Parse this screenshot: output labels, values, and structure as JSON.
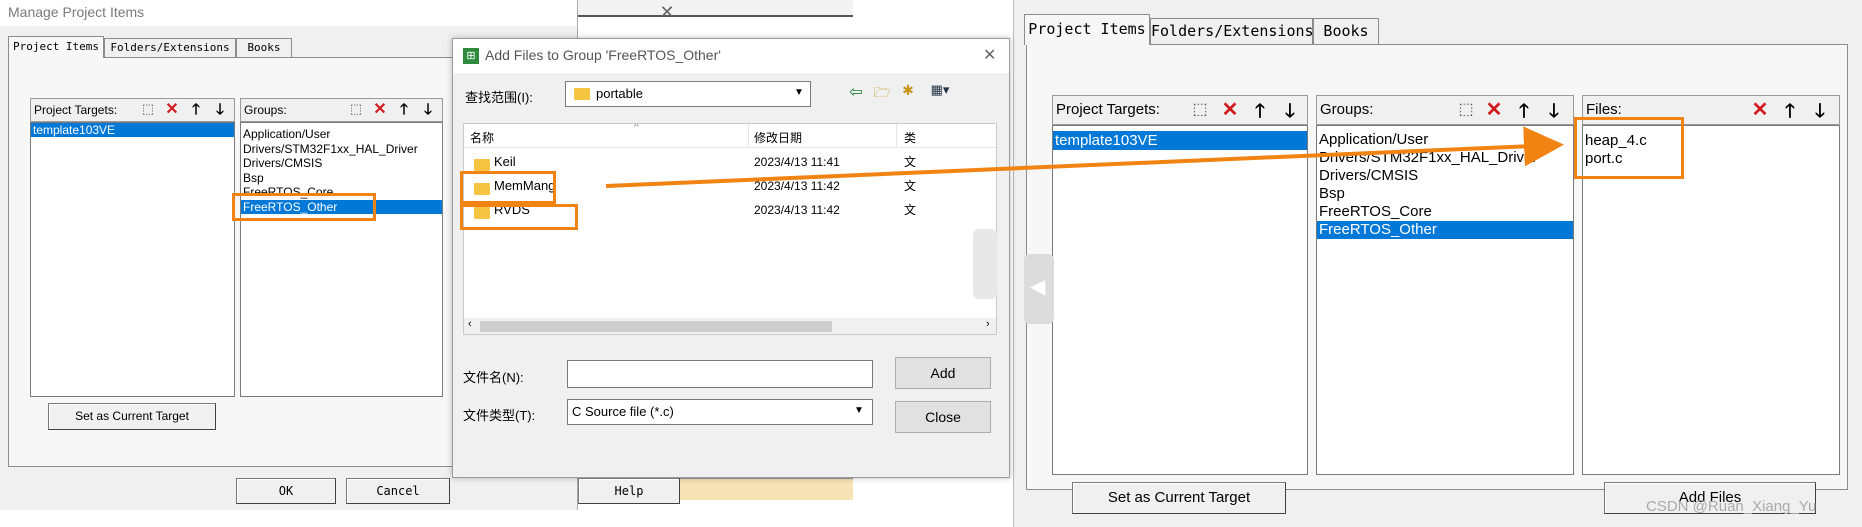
{
  "manage": {
    "title": "Manage Project Items",
    "tabs": [
      "Project Items",
      "Folders/Extensions",
      "Books"
    ],
    "targets_label": "Project Targets:",
    "targets": [
      "template103VE"
    ],
    "groups_label": "Groups:",
    "groups": [
      "Application/User",
      "Drivers/STM32F1xx_HAL_Driver",
      "Drivers/CMSIS",
      "Bsp",
      "FreeRTOS_Core",
      "FreeRTOS_Other"
    ],
    "set_target_button": "Set as Current Target",
    "ok_button": "OK",
    "cancel_button": "Cancel",
    "help_button": "Help"
  },
  "addfiles": {
    "title": "Add Files to Group 'FreeRTOS_Other'",
    "look_in_label": "查找范围(I):",
    "look_in_value": "portable",
    "col_name": "名称",
    "col_date": "修改日期",
    "col_type": "类",
    "rows": [
      {
        "name": "Keil",
        "date": "2023/4/13 11:41",
        "type": "文"
      },
      {
        "name": "MemMang",
        "date": "2023/4/13 11:42",
        "type": "文"
      },
      {
        "name": "RVDS",
        "date": "2023/4/13 11:42",
        "type": "文"
      }
    ],
    "filename_label": "文件名(N):",
    "filename_value": "",
    "filetype_label": "文件类型(T):",
    "filetype_value": "C Source file (*.c)",
    "add_button": "Add",
    "close_button": "Close"
  },
  "right": {
    "tabs": [
      "Project Items",
      "Folders/Extensions",
      "Books"
    ],
    "targets_label": "Project Targets:",
    "targets": [
      "template103VE"
    ],
    "groups_label": "Groups:",
    "groups": [
      "Application/User",
      "Drivers/STM32F1xx_HAL_Driver",
      "Drivers/CMSIS",
      "Bsp",
      "FreeRTOS_Core",
      "FreeRTOS_Other"
    ],
    "files_label": "Files:",
    "files": [
      "heap_4.c",
      "port.c"
    ],
    "set_target_button": "Set as Current Target",
    "add_files_button": "Add Files"
  },
  "watermark": "CSDN @Ruan_Xiang_Yu",
  "colors": {
    "highlight": "#f08312",
    "selection": "#0078d7",
    "dialog_bg": "#f0f0f0"
  },
  "icons": {
    "new": "new-item-icon",
    "delete": "delete-red-x-icon",
    "up": "arrow-up-icon",
    "down": "arrow-down-icon",
    "folder": "folder-icon",
    "back": "back-arrow-icon",
    "up_folder": "up-folder-icon",
    "new_folder": "new-folder-icon",
    "view": "view-menu-icon"
  }
}
